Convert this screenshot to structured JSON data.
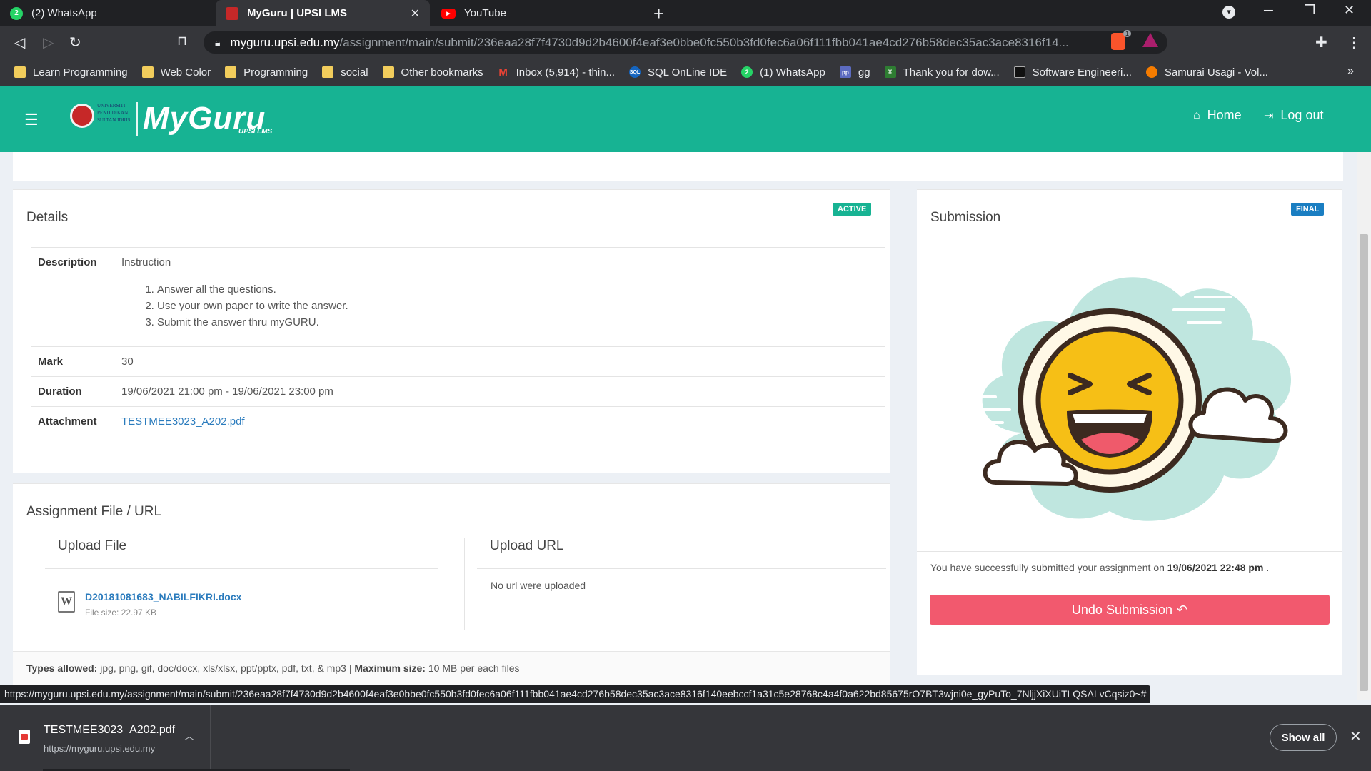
{
  "browser": {
    "tabs": [
      {
        "title": "(2) WhatsApp",
        "icon": "whatsapp-icon",
        "badge": "2"
      },
      {
        "title": "MyGuru | UPSI LMS",
        "icon": "upsi-icon"
      },
      {
        "title": "YouTube",
        "icon": "youtube-icon"
      }
    ],
    "url_host": "myguru.upsi.edu.my",
    "url_path": "/assignment/main/submit/236eaa28f7f4730d9d2b4600f4eaf3e0bbe0fc550b3fd0fec6a06f111fbb041ae4cd276b58dec35ac3ace8316f14...",
    "brave_badge": "1",
    "bookmarks": [
      {
        "label": "Learn Programming",
        "icon": "folder-icon"
      },
      {
        "label": "Web Color",
        "icon": "folder-icon"
      },
      {
        "label": "Programming",
        "icon": "folder-icon"
      },
      {
        "label": "social",
        "icon": "folder-icon"
      },
      {
        "label": "Other bookmarks",
        "icon": "folder-icon"
      },
      {
        "label": "Inbox (5,914) - thin...",
        "icon": "gmail-icon"
      },
      {
        "label": "SQL OnLine IDE",
        "icon": "sql-icon"
      },
      {
        "label": "(1) WhatsApp",
        "icon": "whatsapp-icon"
      },
      {
        "label": "gg",
        "icon": "pp-icon"
      },
      {
        "label": "Thank you for dow...",
        "icon": "download-site-icon"
      },
      {
        "label": "Software Engineeri...",
        "icon": "page-icon"
      },
      {
        "label": "Samurai Usagi - Vol...",
        "icon": "samurai-icon"
      }
    ],
    "status_url": "https://myguru.upsi.edu.my/assignment/main/submit/236eaa28f7f4730d9d2b4600f4eaf3e0bbe0fc550b3fd0fec6a06f111fbb041ae4cd276b58dec35ac3ace8316f140eebccf1a31c5e28768c4a4f0a622bd85675rO7BT3wjni0e_gyPuTo_7NljjXiXUiTLQSALvCqsiz0~#"
  },
  "app": {
    "logo_text": "MyGuru",
    "logo_sub": "UPSI LMS",
    "logo_uni": "UNIVERSITI PENDIDIKAN SULTAN IDRIS",
    "nav": {
      "home": "Home",
      "logout": "Log out"
    },
    "brand_color": "#17b393"
  },
  "details": {
    "title": "Details",
    "status": "ACTIVE",
    "description_label": "Description",
    "description_heading": "Instruction",
    "instructions": [
      "Answer all the questions.",
      "Use your own paper to write the answer.",
      "Submit the answer thru myGURU."
    ],
    "mark_label": "Mark",
    "mark": "30",
    "duration_label": "Duration",
    "duration": "19/06/2021 21:00 pm - 19/06/2021 23:00 pm",
    "attachment_label": "Attachment",
    "attachment": "TESTMEE3023_A202.pdf"
  },
  "assignment_file": {
    "title": "Assignment File / URL",
    "upload_file_heading": "Upload File",
    "file_name": "D20181081683_NABILFIKRI.docx",
    "file_size": "File size: 22.97 KB",
    "upload_url_heading": "Upload URL",
    "url_message": "No url were uploaded",
    "types_label": "Types allowed:",
    "types": "jpg, png, gif, doc/docx, xls/xlsx, ppt/pptx, pdf, txt, & mp3",
    "separator": "|",
    "max_label": "Maximum size:",
    "max_size": "10 MB per each files"
  },
  "submission": {
    "title": "Submission",
    "status": "FINAL",
    "message_prefix": "You have successfully submitted your assignment on",
    "submitted_at": "19/06/2021 22:48 pm",
    "message_suffix": ".",
    "undo_label": "Undo Submission"
  },
  "downloads": {
    "file_name": "TESTMEE3023_A202.pdf",
    "source": "https://myguru.upsi.edu.my",
    "show_all": "Show all"
  },
  "colors": {
    "active_badge": "#17b393",
    "final_badge": "#1a7ec2",
    "undo_button": "#f2596e",
    "link": "#2a7bbd"
  }
}
